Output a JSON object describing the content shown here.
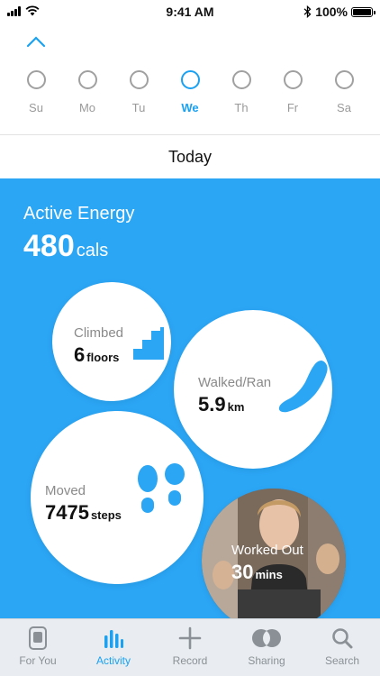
{
  "status_bar": {
    "time": "9:41 AM",
    "battery": "100%"
  },
  "week": {
    "days": [
      "Su",
      "Mo",
      "Tu",
      "We",
      "Th",
      "Fr",
      "Sa"
    ],
    "selected": "We"
  },
  "header": {
    "title": "Today"
  },
  "active_energy": {
    "title": "Active Energy",
    "value": "480",
    "unit": "cals"
  },
  "stats": {
    "climbed": {
      "label": "Climbed",
      "value": "6",
      "unit": "floors"
    },
    "walked": {
      "label": "Walked/Ran",
      "value": "5.9",
      "unit": "km"
    },
    "moved": {
      "label": "Moved",
      "value": "7475",
      "unit": "steps"
    },
    "worked_out": {
      "label": "Worked Out",
      "value": "30",
      "unit": "mins"
    }
  },
  "tabs": [
    {
      "label": "For You",
      "icon": "phone-icon"
    },
    {
      "label": "Activity",
      "icon": "bar-chart-icon"
    },
    {
      "label": "Record",
      "icon": "plus-icon"
    },
    {
      "label": "Sharing",
      "icon": "sharing-icon"
    },
    {
      "label": "Search",
      "icon": "search-icon"
    }
  ],
  "active_tab": "Activity",
  "colors": {
    "accent": "#1aa1f2",
    "panel": "#2ba6f5",
    "tabbar": "#e9edf1"
  }
}
